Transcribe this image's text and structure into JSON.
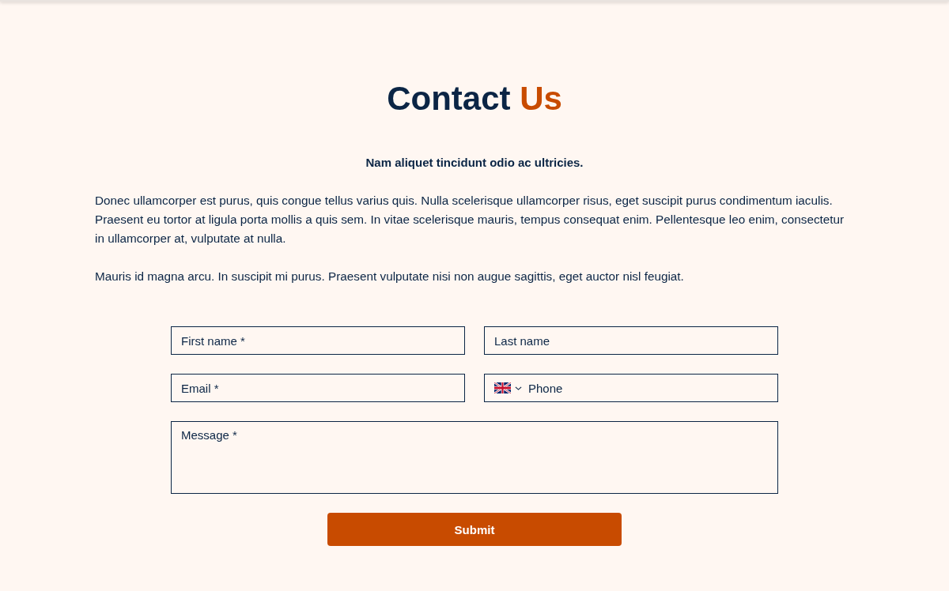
{
  "title": {
    "text": "Contact",
    "accent": "Us"
  },
  "intro": {
    "lead": "Nam aliquet tincidunt odio ac ultricies.",
    "paragraphs": [
      "Donec ullamcorper est purus, quis congue tellus varius quis. Nulla scelerisque ullamcorper risus, eget suscipit purus condimentum iaculis. Praesent eu tortor at ligula porta mollis a quis sem. In vitae scelerisque mauris, tempus consequat enim. Pellentesque leo enim, consectetur in ullamcorper at, vulputate at nulla.",
      "Mauris id magna arcu. In suscipit mi purus. Praesent vulputate nisi non augue sagittis, eget auctor nisl feugiat."
    ]
  },
  "form": {
    "fields": [
      {
        "kind": "text",
        "placeholder": "First name *"
      },
      {
        "kind": "text",
        "placeholder": "Last name"
      },
      {
        "kind": "text",
        "placeholder": "Email *"
      },
      {
        "kind": "phone",
        "placeholder": "Phone"
      },
      {
        "kind": "textarea",
        "placeholder": "Message *"
      }
    ],
    "submit": "Submit"
  }
}
